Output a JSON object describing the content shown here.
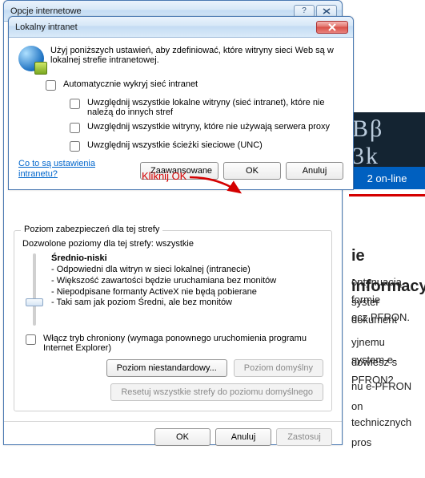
{
  "outer": {
    "title": "Opcje internetowe",
    "group_legend": "Poziom zabezpieczeń dla tej strefy",
    "allowed_levels": "Dozwolone poziomy dla tej strefy: wszystkie",
    "level_name": "Średnio-niski",
    "level_desc": [
      "- Odpowiedni dla witryn w sieci lokalnej (intranecie)",
      "- Większość zawartości będzie uruchamiana bez monitów",
      "- Niepodpisane formanty ActiveX nie będą pobierane",
      "- Taki sam jak poziom Średni, ale bez monitów"
    ],
    "protected_mode": "Włącz tryb chroniony (wymaga ponownego uruchomienia programu Internet Explorer)",
    "btn_custom": "Poziom niestandardowy...",
    "btn_default": "Poziom domyślny",
    "btn_reset": "Resetuj wszystkie strefy do poziomu domyślnego",
    "btn_ok": "OK",
    "btn_cancel": "Anuluj",
    "btn_apply": "Zastosuj"
  },
  "modal": {
    "title": "Lokalny intranet",
    "intro": "Użyj poniższych ustawień, aby zdefiniować, które witryny sieci Web są w lokalnej strefie intranetowej.",
    "auto_detect": "Automatycznie wykryj sieć intranet",
    "opt1": "Uwzględnij wszystkie lokalne witryny (sieć intranet), które nie należą do innych stref",
    "opt2": "Uwzględnij wszystkie witryny, które nie używają serwera proxy",
    "opt3": "Uwzględnij wszystkie ścieżki sieciowe (UNC)",
    "link": "Co to są ustawienia intranetu?",
    "btn_advanced": "Zaawansowane",
    "btn_ok": "OK",
    "btn_cancel": "Anuluj"
  },
  "annotation": {
    "text": "Kliknij OK"
  },
  "bg": {
    "banner": "2 on-line",
    "heading": "ie informacy",
    "l1": "ontynuacją syster",
    "l2": "formie dokument",
    "l3": "ecz PFRON.",
    "l4": "yjnemu dowiesz s",
    "l5": "system e-PFRON2",
    "l6": "nu e-PFRON on",
    "l7": "technicznych pros"
  }
}
